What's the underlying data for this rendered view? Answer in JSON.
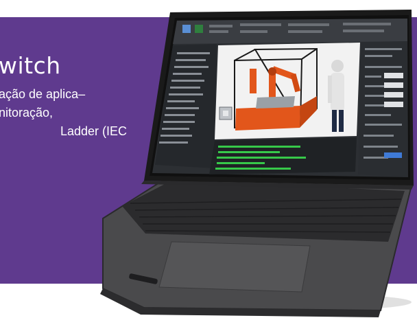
{
  "banner": {
    "background_color": "#5f3a8e",
    "headline": "witch",
    "body_lines": [
      "ação de aplica–",
      "nitoração,",
      "Ladder (IEC"
    ]
  },
  "laptop": {
    "body_color": "#3b3b3d",
    "screen_bezel_color": "#111111",
    "app_ui_color": "#2c2f33",
    "viewport_background": "#f2f2f2",
    "robot_cell_color": "#e2561b",
    "console_text_color": "#37c94a"
  }
}
